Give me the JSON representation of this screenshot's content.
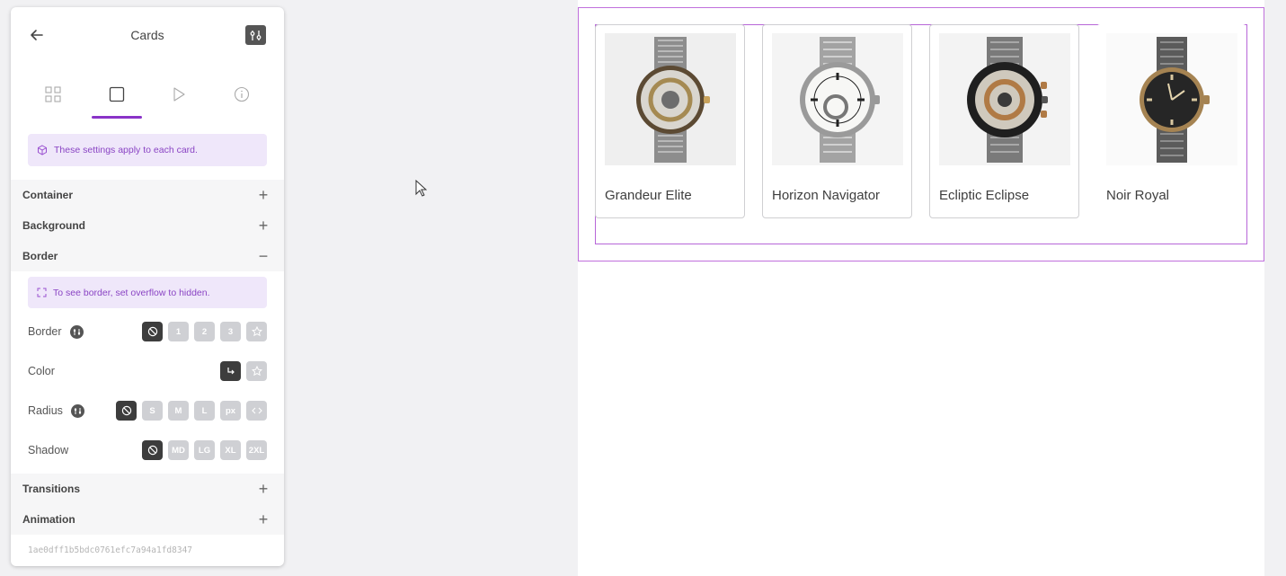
{
  "panel": {
    "title": "Cards",
    "tabs": [
      "layout-tab",
      "card-tab",
      "play-tab",
      "info-tab"
    ],
    "notice": "These settings apply to each card.",
    "sections": {
      "container": "Container",
      "background": "Background",
      "border": "Border",
      "transitions": "Transitions",
      "animation": "Animation"
    },
    "border_notice": "To see border, set overflow to hidden.",
    "props": {
      "border": {
        "label": "Border",
        "options": [
          "1",
          "2",
          "3"
        ]
      },
      "color": {
        "label": "Color"
      },
      "radius": {
        "label": "Radius",
        "options": [
          "S",
          "M",
          "L",
          "px"
        ]
      },
      "shadow": {
        "label": "Shadow",
        "options": [
          "MD",
          "LG",
          "XL",
          "2XL"
        ]
      }
    },
    "footer_id": "1ae0dff1b5bdc0761efc7a94a1fd8347"
  },
  "cards": [
    {
      "name": "Grandeur Elite"
    },
    {
      "name": "Horizon Navigator"
    },
    {
      "name": "Ecliptic Eclipse"
    },
    {
      "name": "Noir Royal"
    }
  ],
  "colors": {
    "accent": "#8a33c8",
    "notice_bg": "#efe7fa",
    "active_option": "#3d3d3d",
    "inactive_option": "#cfd0d4"
  }
}
